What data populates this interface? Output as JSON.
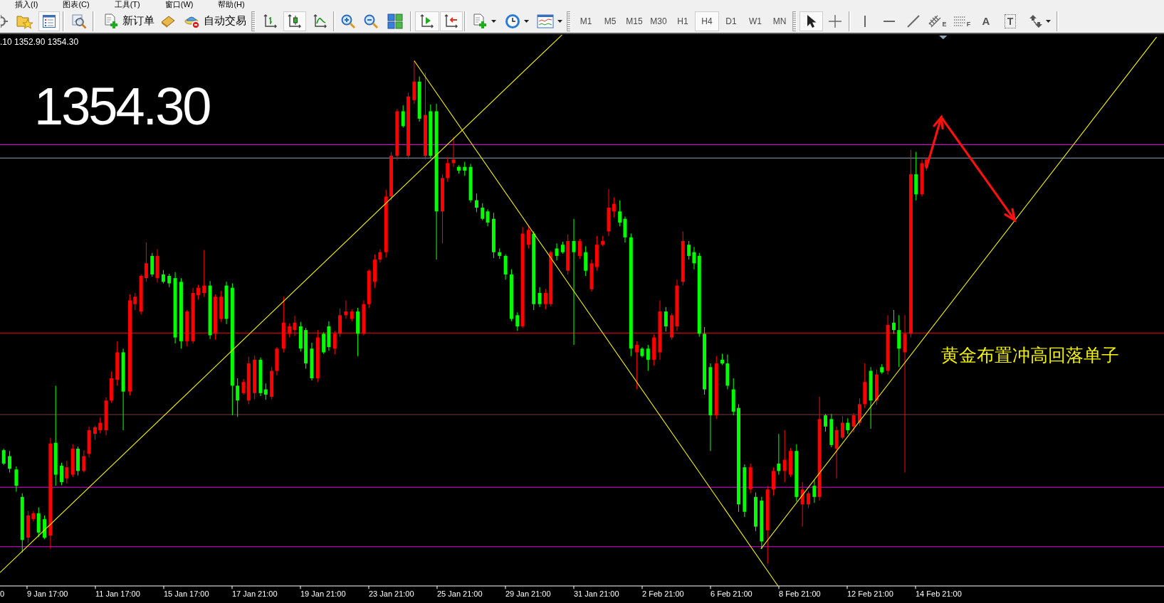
{
  "menu": [
    "插入(I)",
    "图表(C)",
    "工具(T)",
    "窗口(W)",
    "帮助(H)"
  ],
  "toolbar": {
    "groups": [
      [
        {
          "kind": "target"
        },
        {
          "kind": "profiles"
        },
        {
          "kind": "navigator",
          "on": true
        }
      ],
      [
        {
          "kind": "zoomchart"
        }
      ],
      [
        {
          "kind": "order",
          "label": "新订单"
        },
        {
          "kind": "gold"
        },
        {
          "kind": "autotrade",
          "label": "自动交易"
        }
      ],
      [
        {
          "kind": "bars",
          "selected": false
        },
        {
          "kind": "candles",
          "selected": true
        },
        {
          "kind": "line",
          "selected": false
        }
      ],
      [
        {
          "kind": "zoomin"
        },
        {
          "kind": "zoomout"
        },
        {
          "kind": "tile"
        }
      ],
      [
        {
          "kind": "shift",
          "on": true
        },
        {
          "kind": "autoscroll",
          "on": true
        }
      ],
      [
        {
          "kind": "indicators"
        },
        {
          "kind": "clock"
        },
        {
          "kind": "templates"
        }
      ],
      [
        {
          "kind": "timeframe",
          "label": "M1",
          "selected": false
        },
        {
          "kind": "timeframe",
          "label": "M5",
          "selected": false
        },
        {
          "kind": "timeframe",
          "label": "M15",
          "selected": false
        },
        {
          "kind": "timeframe",
          "label": "M30",
          "selected": false
        },
        {
          "kind": "timeframe",
          "label": "H1",
          "selected": false
        },
        {
          "kind": "timeframe",
          "label": "H4",
          "selected": true
        },
        {
          "kind": "timeframe",
          "label": "D1",
          "selected": false
        },
        {
          "kind": "timeframe",
          "label": "W1",
          "selected": false
        },
        {
          "kind": "timeframe",
          "label": "MN",
          "selected": false
        }
      ],
      [
        {
          "kind": "cursor",
          "selected": true
        },
        {
          "kind": "crosshair",
          "selected": false
        }
      ],
      [
        {
          "kind": "vline"
        },
        {
          "kind": "hline"
        },
        {
          "kind": "trend"
        },
        {
          "kind": "fibo",
          "glyph": "E"
        },
        {
          "kind": "fibolines",
          "glyph": "F"
        },
        {
          "kind": "text",
          "glyph": "A"
        },
        {
          "kind": "label",
          "glyph": "T"
        },
        {
          "kind": "arrows"
        }
      ]
    ]
  },
  "chart": {
    "readout": ".10 1352.90 1354.30",
    "price": "1354.30",
    "note": "黄金布置冲高回落单子",
    "time_labels": [
      "0",
      "9 Jan 17:00",
      "11 Jan 17:00",
      "15 Jan 17:00",
      "17 Jan 21:00",
      "19 Jan 21:00",
      "23 Jan 21:00",
      "25 Jan 21:00",
      "29 Jan 21:00",
      "31 Jan 21:00",
      "2 Feb 21:00",
      "6 Feb 21:00",
      "8 Feb 21:00",
      "12 Feb 21:00",
      "14 Feb 21:00"
    ]
  }
}
